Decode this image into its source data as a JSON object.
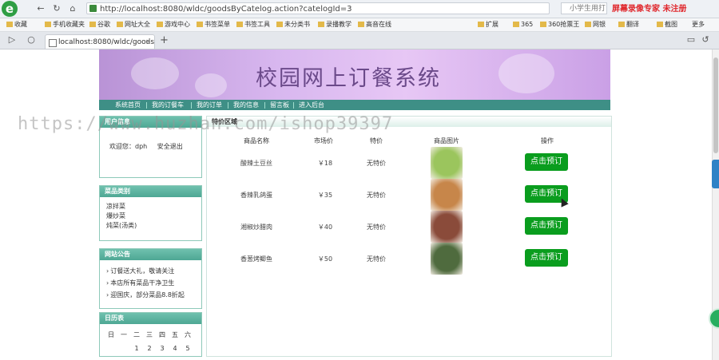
{
  "browser": {
    "address": "http://localhost:8080/wldc/goodsByCatelog.action?catelogId=3",
    "search_text": "小学生用打",
    "recorder_tag": "屏幕录像专家 未注册",
    "tab_title": "localhost:8080/wldc/goodsB",
    "tab_close": "×",
    "new_tab": "+"
  },
  "bookmarks": [
    "收藏",
    "手机收藏夹",
    "谷歌",
    "网址大全",
    "游戏中心",
    "书签菜单",
    "书签工具",
    "未分类书",
    "录播教学",
    "高音在线"
  ],
  "bookmarks_right": [
    "扩展",
    "365",
    "360抢票王",
    "网银",
    "翻译",
    "截图",
    "更多"
  ],
  "site": {
    "title": "校园网上订餐系统",
    "menu": [
      "系统首页",
      "我的订餐车",
      "我的订单",
      "我的信息",
      "留言板",
      "进入后台"
    ],
    "watermark": "https://www.huzhan.com/ishop39397"
  },
  "user_panel": {
    "header": "用户信息",
    "welcome": "欢迎您：",
    "username": "dph",
    "logout": "安全退出"
  },
  "category_panel": {
    "header": "菜品类别",
    "items": [
      "凉拌菜",
      "爆炒菜",
      "炖菜(汤类)"
    ]
  },
  "notice_panel": {
    "header": "网站公告",
    "items": [
      "订餐送大礼，敬请关注",
      "本店所有菜品干净卫生",
      "迎国庆，部分菜品8.8折起"
    ]
  },
  "calendar_panel": {
    "header": "日历表",
    "weekdays": [
      "日",
      "一",
      "二",
      "三",
      "四",
      "五",
      "六"
    ],
    "first_row": [
      "1",
      "2",
      "3",
      "4",
      "5"
    ]
  },
  "main": {
    "header": "特价区域",
    "columns": [
      "商品名称",
      "市场价",
      "特价",
      "商品图片",
      "操作"
    ],
    "rows": [
      {
        "name": "酸辣土豆丝",
        "price": "￥18",
        "special": "无特价",
        "button": "点击预订",
        "img_color": "#9bc55d"
      },
      {
        "name": "香辣乳鸽蛋",
        "price": "￥35",
        "special": "无特价",
        "button": "点击预订",
        "img_color": "#c7864a"
      },
      {
        "name": "湘椒炒腊肉",
        "price": "￥40",
        "special": "无特价",
        "button": "点击预订",
        "img_color": "#8a4b3a"
      },
      {
        "name": "香葱烤鲫鱼",
        "price": "￥50",
        "special": "无特价",
        "button": "点击预订",
        "img_color": "#4f6b3e"
      }
    ]
  }
}
